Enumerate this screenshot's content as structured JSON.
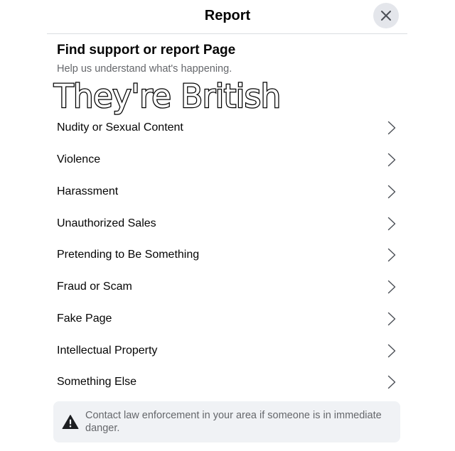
{
  "header": {
    "title": "Report",
    "close_icon": "close-icon"
  },
  "section": {
    "title": "Find support or report Page",
    "subtitle": "Help us understand what's happening."
  },
  "overlay": {
    "caption": "They're British"
  },
  "options": [
    {
      "label": "Nudity or Sexual Content",
      "icon": "chevron-right-icon"
    },
    {
      "label": "Violence",
      "icon": "chevron-right-icon"
    },
    {
      "label": "Harassment",
      "icon": "chevron-right-icon"
    },
    {
      "label": "Unauthorized Sales",
      "icon": "chevron-right-icon"
    },
    {
      "label": "Pretending to Be Something",
      "icon": "chevron-right-icon"
    },
    {
      "label": "Fraud or Scam",
      "icon": "chevron-right-icon"
    },
    {
      "label": "Fake Page",
      "icon": "chevron-right-icon"
    },
    {
      "label": "Intellectual Property",
      "icon": "chevron-right-icon"
    },
    {
      "label": "Something Else",
      "icon": "chevron-right-icon"
    }
  ],
  "notice": {
    "icon": "warning-icon",
    "text": "Contact law enforcement in your area if someone is in immediate danger."
  },
  "colors": {
    "background": "#ffffff",
    "close_button_bg": "#e4e6eb",
    "primary_text": "#050505",
    "secondary_text": "#65676b",
    "notice_bg": "#f0f2f5",
    "divider": "#dadde1"
  }
}
